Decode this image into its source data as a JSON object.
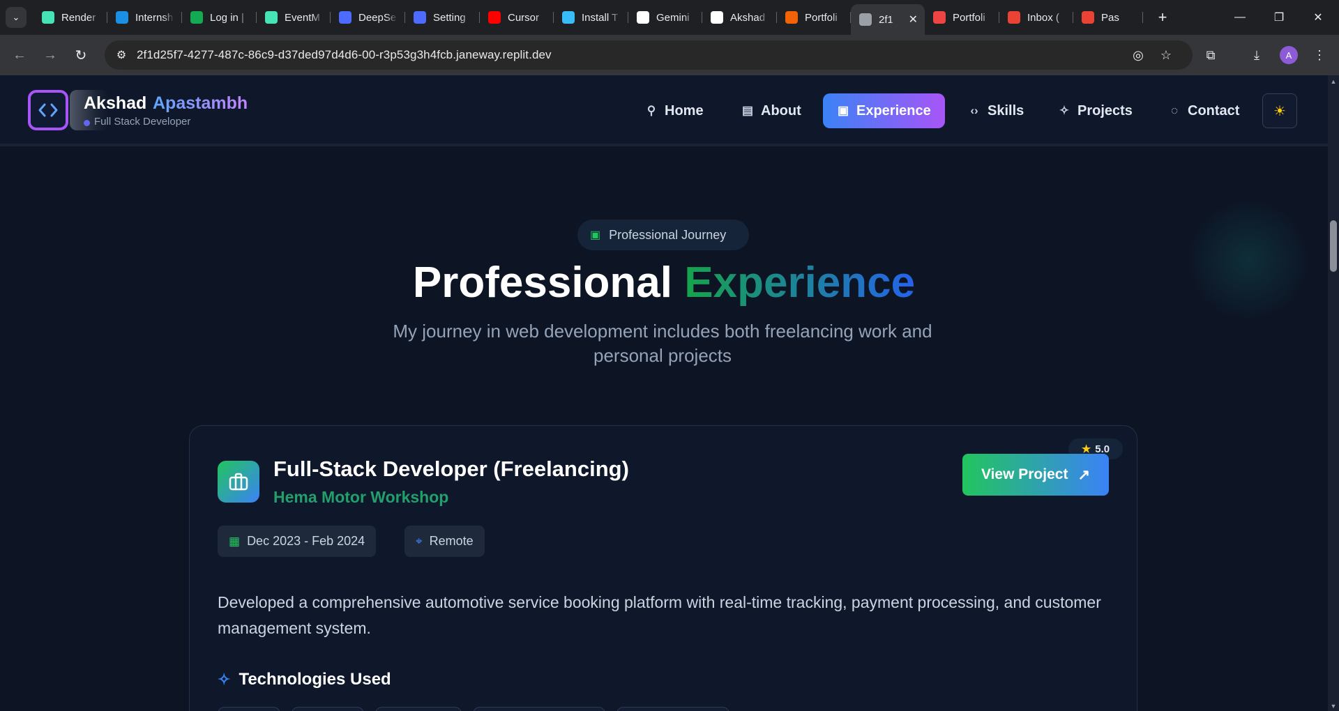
{
  "browser": {
    "tabs": [
      {
        "label": "Render",
        "icon": "render-icon",
        "color": "#46e3b7"
      },
      {
        "label": "Internsh",
        "icon": "internshala-icon",
        "color": "#1a8fe3"
      },
      {
        "label": "Log in |",
        "icon": "mongodb-icon",
        "color": "#13aa52"
      },
      {
        "label": "EventM",
        "icon": "render-icon",
        "color": "#46e3b7"
      },
      {
        "label": "DeepSe",
        "icon": "deepseek-icon",
        "color": "#4d6bfe"
      },
      {
        "label": "Setting",
        "icon": "deepseek-icon",
        "color": "#4d6bfe"
      },
      {
        "label": "Cursor",
        "icon": "youtube-icon",
        "color": "#ff0000"
      },
      {
        "label": "Install T",
        "icon": "tailwind-icon",
        "color": "#38bdf8"
      },
      {
        "label": "Gemini",
        "icon": "openai-icon",
        "color": "#ffffff"
      },
      {
        "label": "Akshad",
        "icon": "github-icon",
        "color": "#ffffff"
      },
      {
        "label": "Portfoli",
        "icon": "replit-icon",
        "color": "#f26207"
      },
      {
        "label": "2f1",
        "icon": "globe-icon",
        "color": "#9aa0a6",
        "active": true
      },
      {
        "label": "Portfoli",
        "icon": "render-icon",
        "color": "#ef4444"
      },
      {
        "label": "Inbox (",
        "icon": "gmail-icon",
        "color": "#ea4335"
      },
      {
        "label": "Pas",
        "icon": "gmail-icon",
        "color": "#ea4335"
      }
    ],
    "url": "2f1d25f7-4277-487c-86c9-d37ded97d4d6-00-r3p53g3h4fcb.janeway.replit.dev",
    "profile_initial": "A"
  },
  "site": {
    "brand_first": "Akshad",
    "brand_last": "Apastambh",
    "brand_subtitle": "Full Stack Developer",
    "nav": [
      {
        "label": "Home",
        "icon": "user-icon"
      },
      {
        "label": "About",
        "icon": "document-icon"
      },
      {
        "label": "Experience",
        "icon": "briefcase-icon",
        "active": true
      },
      {
        "label": "Skills",
        "icon": "code-icon"
      },
      {
        "label": "Projects",
        "icon": "sparkles-icon"
      },
      {
        "label": "Contact",
        "icon": "chat-icon"
      }
    ]
  },
  "section": {
    "badge": "Professional Journey",
    "title_plain": "Professional",
    "title_accent": "Experience",
    "lead": "My journey in web development includes both freelancing work and personal projects"
  },
  "experience": {
    "role": "Full-Stack Developer (Freelancing)",
    "company": "Hema Motor Workshop",
    "rating": "5.0",
    "button_label": "View Project",
    "dates": "Dec 2023 - Feb 2024",
    "location": "Remote",
    "description": "Developed a comprehensive automotive service booking platform with real-time tracking, payment processing, and customer management system.",
    "tech_heading": "Technologies Used"
  },
  "colors": {
    "accent_green": "#22c55e",
    "accent_blue": "#3b82f6",
    "accent_purple": "#a855f7",
    "background": "#0d1424"
  }
}
